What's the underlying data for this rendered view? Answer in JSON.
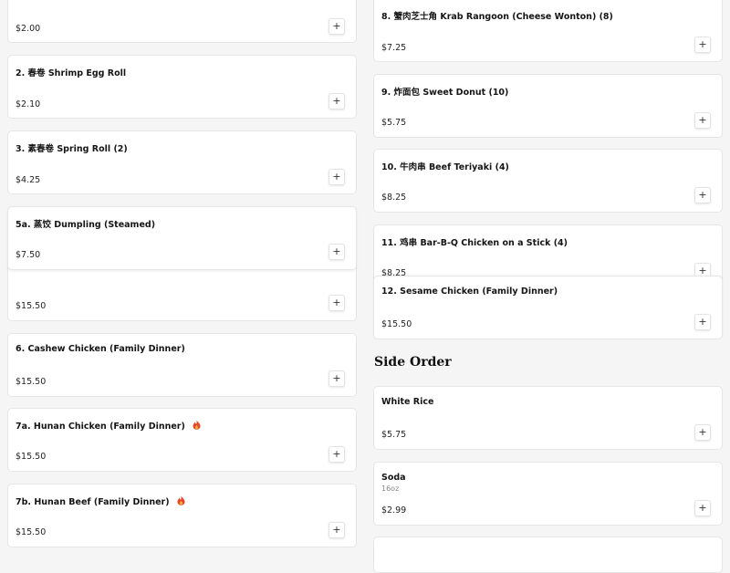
{
  "left_column": [
    {
      "name": "",
      "price": "$2.00",
      "add": "+"
    },
    {
      "name": "2. 春卷 Shrimp Egg Roll",
      "price": "$2.10",
      "add": "+"
    },
    {
      "name": "3. 素春卷 Spring Roll (2)",
      "price": "$4.25",
      "add": "+"
    },
    {
      "name": "5a. 蒸饺 Dumpling (Steamed)",
      "price": "$7.50",
      "add": "+"
    },
    {
      "name": "",
      "price": "$15.50",
      "add": "+"
    },
    {
      "name": "6. Cashew Chicken (Family Dinner)",
      "price": "$15.50",
      "add": "+"
    },
    {
      "name": "7a. Hunan Chicken (Family Dinner)",
      "price": "$15.50",
      "add": "+",
      "icon": "spicy-fire-icon"
    },
    {
      "name": "7b. Hunan Beef (Family Dinner)",
      "price": "$15.50",
      "add": "+",
      "icon": "spicy-fire-icon"
    }
  ],
  "right_column": [
    {
      "name": "8. 蟹肉芝士角 Krab Rangoon (Cheese Wonton) (8)",
      "price": "$7.25",
      "add": "+"
    },
    {
      "name": "9. 炸面包 Sweet Donut (10)",
      "price": "$5.75",
      "add": "+"
    },
    {
      "name": "10. 牛肉串 Beef Teriyaki (4)",
      "price": "$8.25",
      "add": "+"
    },
    {
      "name": "11. 鸡串 Bar-B-Q Chicken on a Stick (4)",
      "price": "$8.25",
      "add": "+"
    },
    {
      "name": "12. Sesame Chicken (Family Dinner)",
      "price": "$15.50",
      "add": "+"
    }
  ],
  "side_order": {
    "heading": "Side Order",
    "items": [
      {
        "name": "White Rice",
        "price": "$5.75",
        "add": "+"
      },
      {
        "name": "Soda",
        "size": "16oz",
        "price": "$2.99",
        "add": "+"
      }
    ]
  },
  "colors": {
    "accent": "#e8452c",
    "card_bg": "#ffffff",
    "page_bg": "#f5f5f5"
  }
}
